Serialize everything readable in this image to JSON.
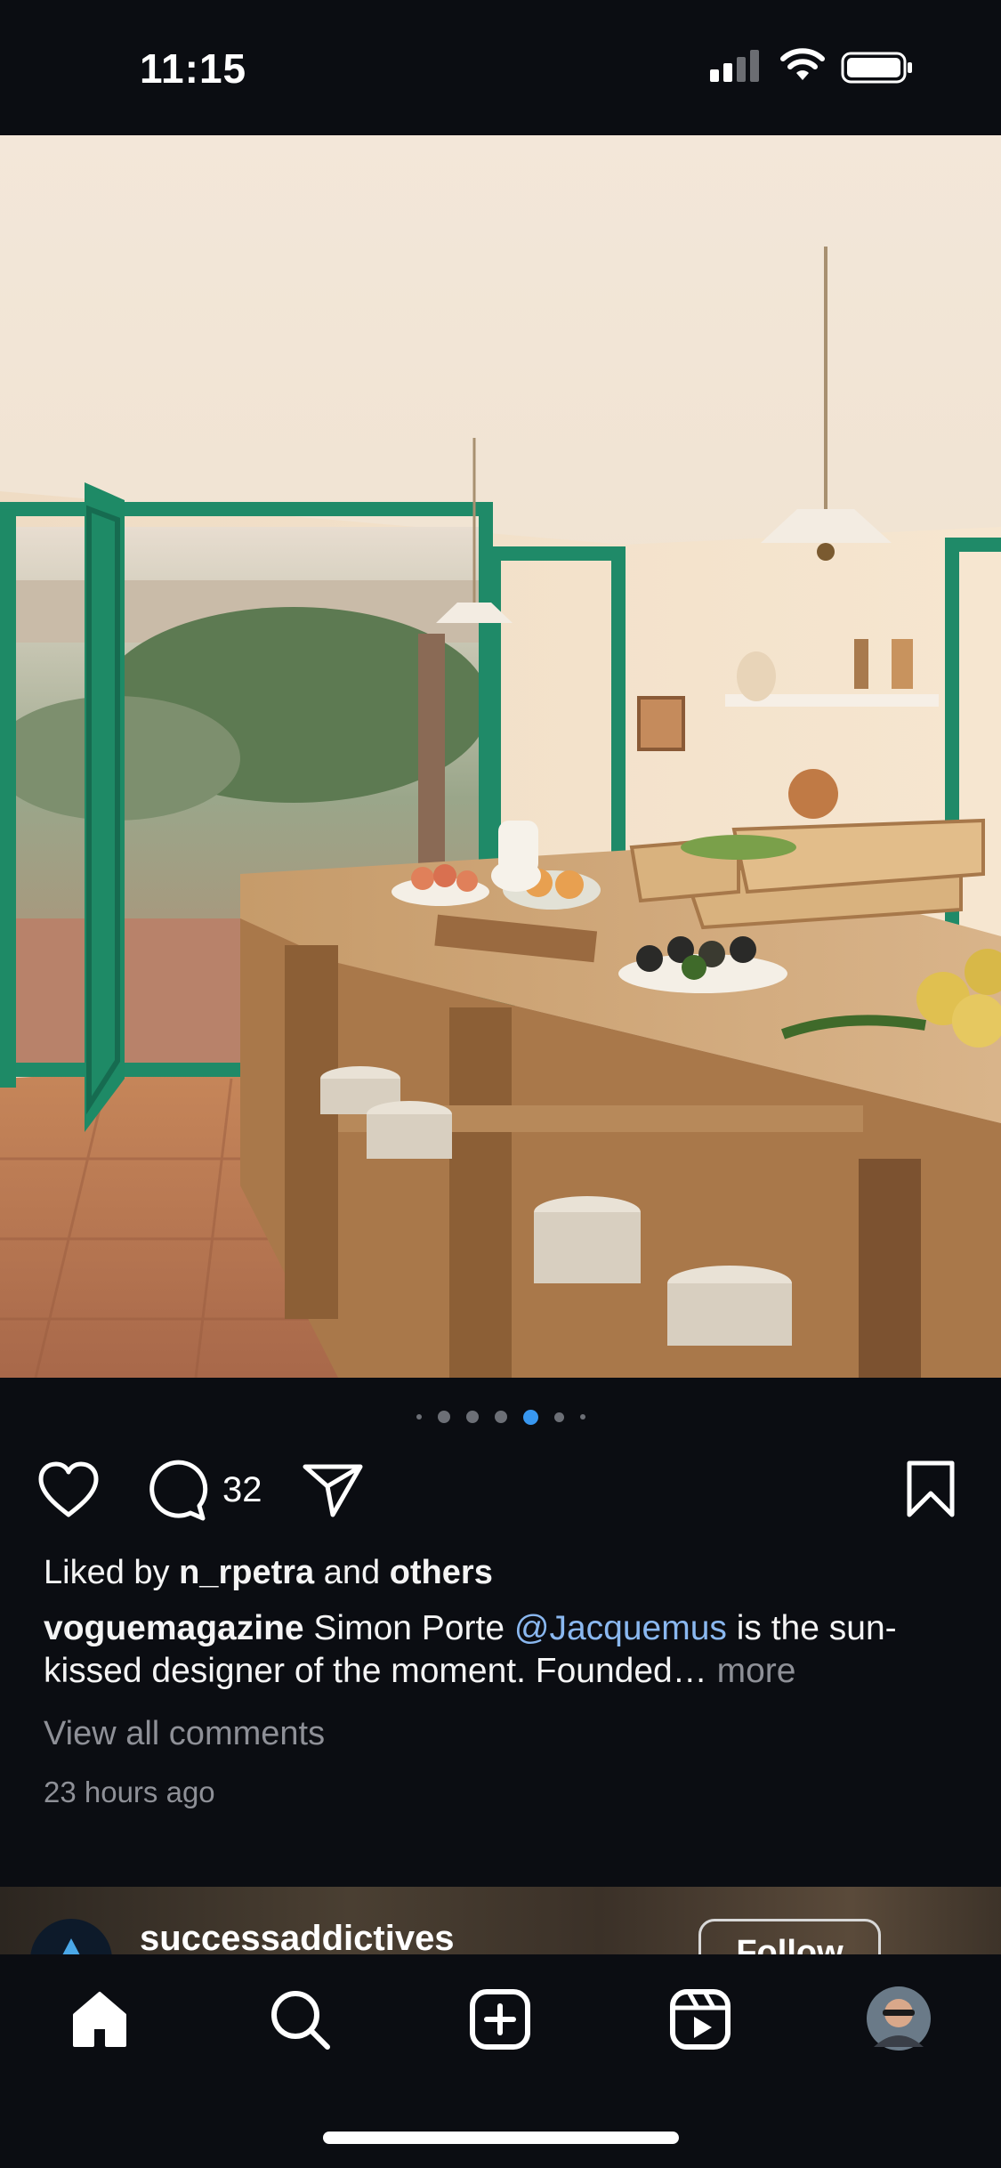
{
  "status_bar": {
    "time": "11:15"
  },
  "post": {
    "photo_alt": "Sunlit kitchen with green-framed doors, large wooden table with fruit, plates and crates",
    "carousel": {
      "total_dots": 7,
      "active_index": 4
    },
    "comment_count": "32",
    "likes": {
      "prefix": "Liked by ",
      "user": "n_rpetra",
      "middle": " and ",
      "suffix": "others"
    },
    "caption": {
      "username": "voguemagazine",
      "text_before": " Simon Porte ",
      "mention": "@Jacquemus",
      "text_after": " is the sun-kissed designer of the moment. Founded… ",
      "more": "more"
    },
    "view_all_comments": "View all comments",
    "timestamp": "23 hours ago"
  },
  "next_post": {
    "username": "successaddictives",
    "follow_label": "Follow"
  },
  "icons": {
    "like": "heart-icon",
    "comment": "comment-icon",
    "share": "send-icon",
    "save": "bookmark-icon",
    "home": "home-icon",
    "search": "search-icon",
    "create": "plus-square-icon",
    "reels": "reels-icon",
    "profile": "profile-avatar"
  },
  "colors": {
    "background": "#0b0d12",
    "accent": "#3897f0",
    "mention": "#8ab8f0",
    "muted": "#8e9097"
  }
}
